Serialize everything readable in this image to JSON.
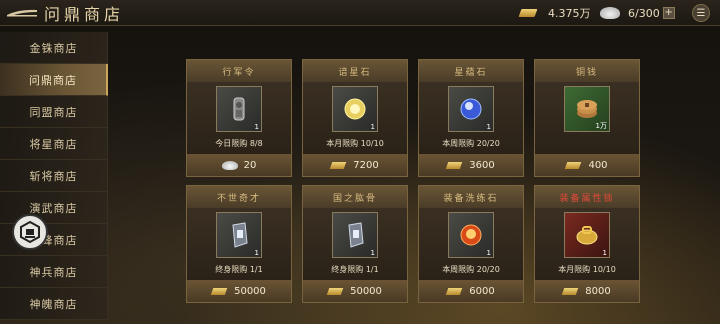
{
  "header": {
    "title": "问鼎商店"
  },
  "resources": {
    "gold_amount": "4.375万",
    "jade_amount": "6/300",
    "plus_label": "+"
  },
  "sidebar": {
    "items": [
      {
        "label": "金铢商店"
      },
      {
        "label": "问鼎商店",
        "active": true
      },
      {
        "label": "同盟商店"
      },
      {
        "label": "将星商店"
      },
      {
        "label": "斩将商店"
      },
      {
        "label": "演武商店"
      },
      {
        "label": "巅峰商店"
      },
      {
        "label": "神兵商店"
      },
      {
        "label": "神魄商店"
      }
    ]
  },
  "shop": {
    "items": [
      {
        "name": "行军令",
        "limit": "今日限购 8/8",
        "qty": "1",
        "price": "20",
        "currency": "jade",
        "icon": "token-icon"
      },
      {
        "name": "谙星石",
        "limit": "本月限购 10/10",
        "qty": "1",
        "price": "7200",
        "currency": "gold",
        "icon": "star-stone-icon"
      },
      {
        "name": "星蕴石",
        "limit": "本周限购 20/20",
        "qty": "1",
        "price": "3600",
        "currency": "gold",
        "icon": "blue-orb-icon"
      },
      {
        "name": "铜钱",
        "limit": "",
        "qty": "1万",
        "price": "400",
        "currency": "gold",
        "icon": "coins-icon"
      },
      {
        "name": "不世奇才",
        "limit": "终身限购 1/1",
        "qty": "1",
        "price": "50000",
        "currency": "gold",
        "icon": "scroll-icon"
      },
      {
        "name": "国之肱骨",
        "limit": "终身限购 1/1",
        "qty": "1",
        "price": "50000",
        "currency": "gold",
        "icon": "scroll-icon"
      },
      {
        "name": "装备洗练石",
        "limit": "本周限购 20/20",
        "qty": "1",
        "price": "6000",
        "currency": "gold",
        "icon": "fire-orb-icon"
      },
      {
        "name": "装备属性锁",
        "limit": "本月限购 10/10",
        "qty": "1",
        "price": "8000",
        "currency": "gold",
        "icon": "gold-lock-icon",
        "highlight": true
      }
    ]
  },
  "colors": {
    "accent_gold": "#c8a45c",
    "highlight_red": "#e04a3a"
  }
}
